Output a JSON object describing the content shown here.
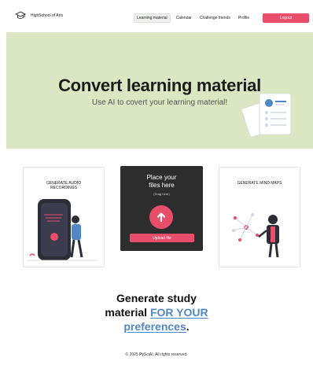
{
  "nav": {
    "brand": "HighSchool of Arts",
    "links": [
      "Learning material",
      "Calendar",
      "Challenge friends",
      "Profile"
    ],
    "active_index": 0,
    "logout_label": "Logout"
  },
  "hero": {
    "title": "Convert learning material",
    "subtitle": "Use AI to covert your learning material!"
  },
  "cards": {
    "audio_label": "GENERATE AUDIO RECORDINGS",
    "mind_label": "GENERATE MIND MAPS"
  },
  "upload": {
    "title_line1": "Place your",
    "title_line2": "files here",
    "hint": "(Drag here)",
    "button_label": "Upload file"
  },
  "tagline": {
    "line1": "Generate study",
    "line2_plain": "material ",
    "line2_highlight": "FOR YOUR",
    "line3_highlight": "preferences",
    "line3_end": "."
  },
  "footer": "© 2025 PySciAI. All rights reserved.",
  "colors": {
    "accent": "#e84d6a",
    "hero_bg": "#dbe6c2",
    "highlight": "#4f87c7",
    "upload_bg": "#2d2d2d"
  }
}
